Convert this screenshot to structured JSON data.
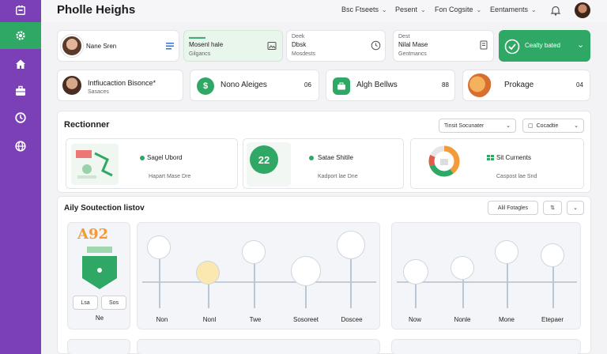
{
  "app": {
    "title": "Pholle Heighs"
  },
  "nav": [
    {
      "label": "Bsc Ftseets"
    },
    {
      "label": "Pesent"
    },
    {
      "label": "Fon Cogsite"
    },
    {
      "label": "Eentaments"
    }
  ],
  "profile_card": {
    "name": "Nane Sren"
  },
  "stat_cards": [
    {
      "title": "Mosenl hale",
      "sub": "Gilgancs"
    },
    {
      "title": "Dbsk",
      "label_top": "Deek",
      "sub": "Mosdests"
    },
    {
      "title": "Nilal Mase",
      "label_top": "Dest",
      "sub": "Gentmancs"
    }
  ],
  "cta": {
    "label": "Cealty bated"
  },
  "highlights": [
    {
      "title": "Intfiucaction Bisonce*",
      "sub": "Sasaces"
    },
    {
      "title": "Nono Aleiges",
      "value": "06"
    },
    {
      "title": "Algh Bellws",
      "value": "88"
    },
    {
      "title": "Prokage",
      "value": "04"
    }
  ],
  "section1": {
    "title": "Rectionner",
    "filter1": "Tinsit Socunater",
    "filter2": "Cocadtie",
    "items": [
      {
        "title": "Sagel Ubord",
        "sub": "Hapart Mase Dre"
      },
      {
        "title": "Satae Shitile",
        "sub": "Kadport lae Dne",
        "badge": "22"
      },
      {
        "title": "Sit Curnents",
        "sub": "Caspost lae Snd"
      }
    ]
  },
  "section2": {
    "title": "Aily Soutection listov",
    "button": "Alil Fotagles",
    "left_card": {
      "tag": "A92",
      "btn1": "Lsa",
      "btn2": "Sos",
      "footer": "Ne"
    },
    "timeline1_labels": [
      "Non",
      "Nonl",
      "Twe",
      "Sosoreet",
      "Doscee"
    ],
    "timeline2_labels": [
      "Now",
      "Nonle",
      "Mone",
      "Etepaer"
    ]
  },
  "colors": {
    "purple": "#7b3fb6",
    "green": "#2fa865",
    "orange": "#f29b38"
  }
}
